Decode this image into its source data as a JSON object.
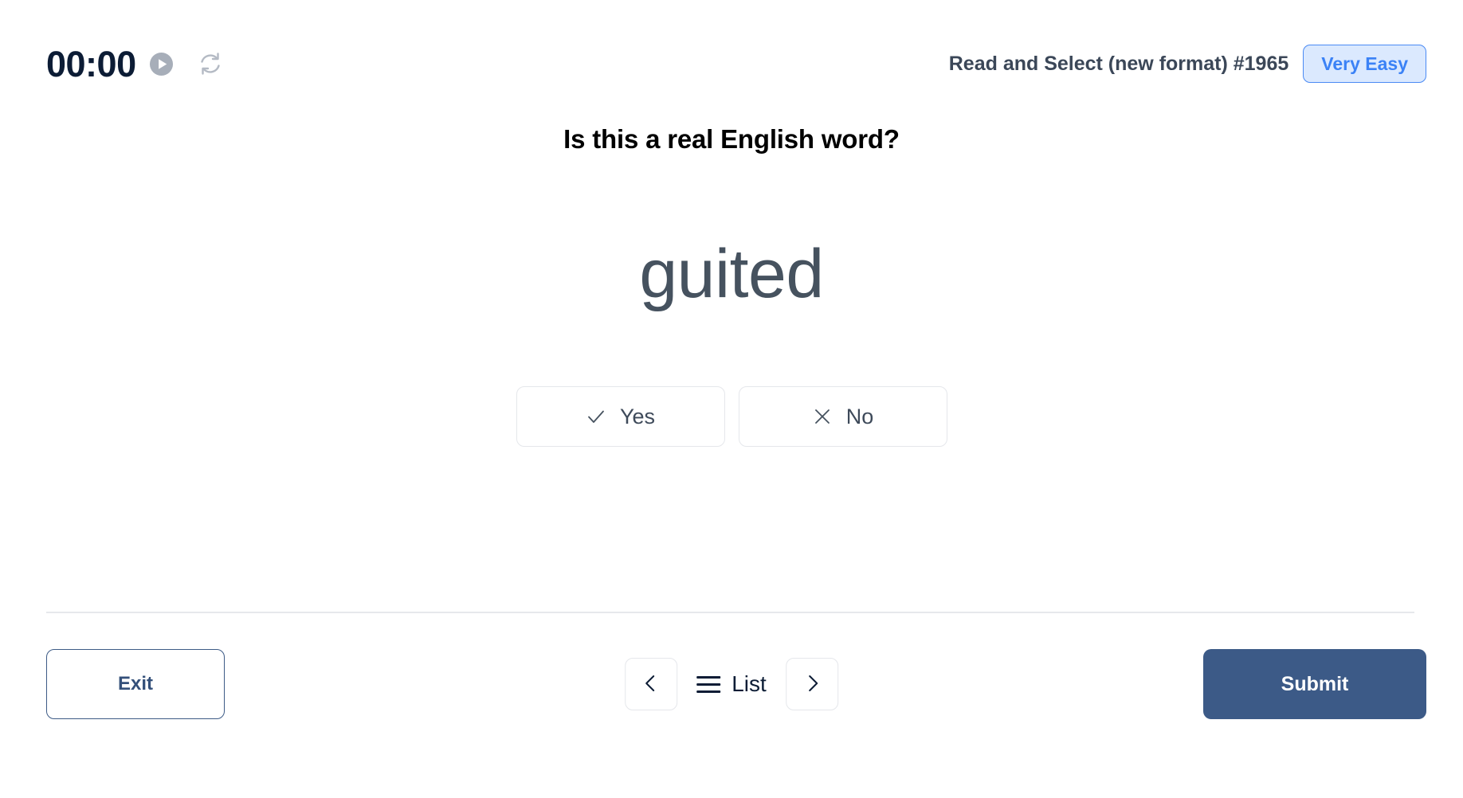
{
  "header": {
    "timer": "00:00",
    "play_icon": "play-circle-icon",
    "refresh_icon": "refresh-icon",
    "exercise_title": "Read and Select (new format) #1965",
    "difficulty_label": "Very Easy",
    "difficulty_color": "#3b82f6",
    "difficulty_bg": "#dbe9fe"
  },
  "question": {
    "prompt": "Is this a real English word?",
    "word": "guited"
  },
  "choices": [
    {
      "label": "Yes",
      "icon": "check-icon"
    },
    {
      "label": "No",
      "icon": "close-icon"
    }
  ],
  "footer": {
    "exit_label": "Exit",
    "prev_icon": "chevron-left-icon",
    "list_label": "List",
    "list_icon": "hamburger-icon",
    "next_icon": "chevron-right-icon",
    "submit_label": "Submit",
    "submit_color": "#3c5a87"
  }
}
